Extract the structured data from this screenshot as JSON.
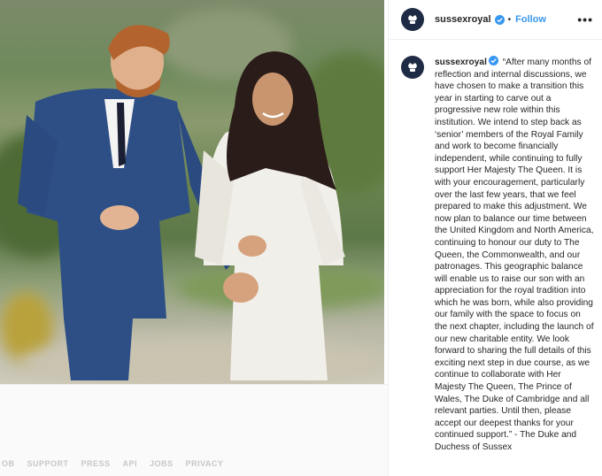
{
  "post": {
    "username": "sussexroyal",
    "follow_label": "Follow",
    "header_separator": "•",
    "more_label": "•••",
    "caption": "“After many months of reflection and internal discussions, we have chosen to make a transition this year in starting to carve out a progressive new role within this institution. We intend to step back as ‘senior’ members of the Royal Family and work to become financially independent, while continuing to fully support Her Majesty The Queen. It is with your encouragement, particularly over the last few years, that we feel prepared to make this adjustment. We now plan to balance our time between the United Kingdom and North America, continuing to honour our duty to The Queen, the Commonwealth, and our patronages. This geographic balance will enable us to raise our son with an appreciation for the royal tradition into which he was born, while also providing our family with the space to focus on the next chapter, including the launch of our new charitable entity. We look forward to sharing the full details of this exciting next step in due course, as we continue to collaborate with Her Majesty The Queen, The Prince of Wales, The Duke of Cambridge and all relevant parties. Until then, please accept our deepest thanks for your continued support.” - The Duke and Duchess of Sussex",
    "icons": {
      "avatar": "royal-crest-icon",
      "verified": "verified-badge-icon",
      "more": "more-options-icon"
    },
    "colors": {
      "follow": "#3897f0",
      "verified": "#3897f0",
      "avatar_bg": "#1f2a44"
    }
  },
  "footer": {
    "links": [
      "OB",
      "SUPPORT",
      "PRESS",
      "API",
      "JOBS",
      "PRIVACY"
    ]
  }
}
